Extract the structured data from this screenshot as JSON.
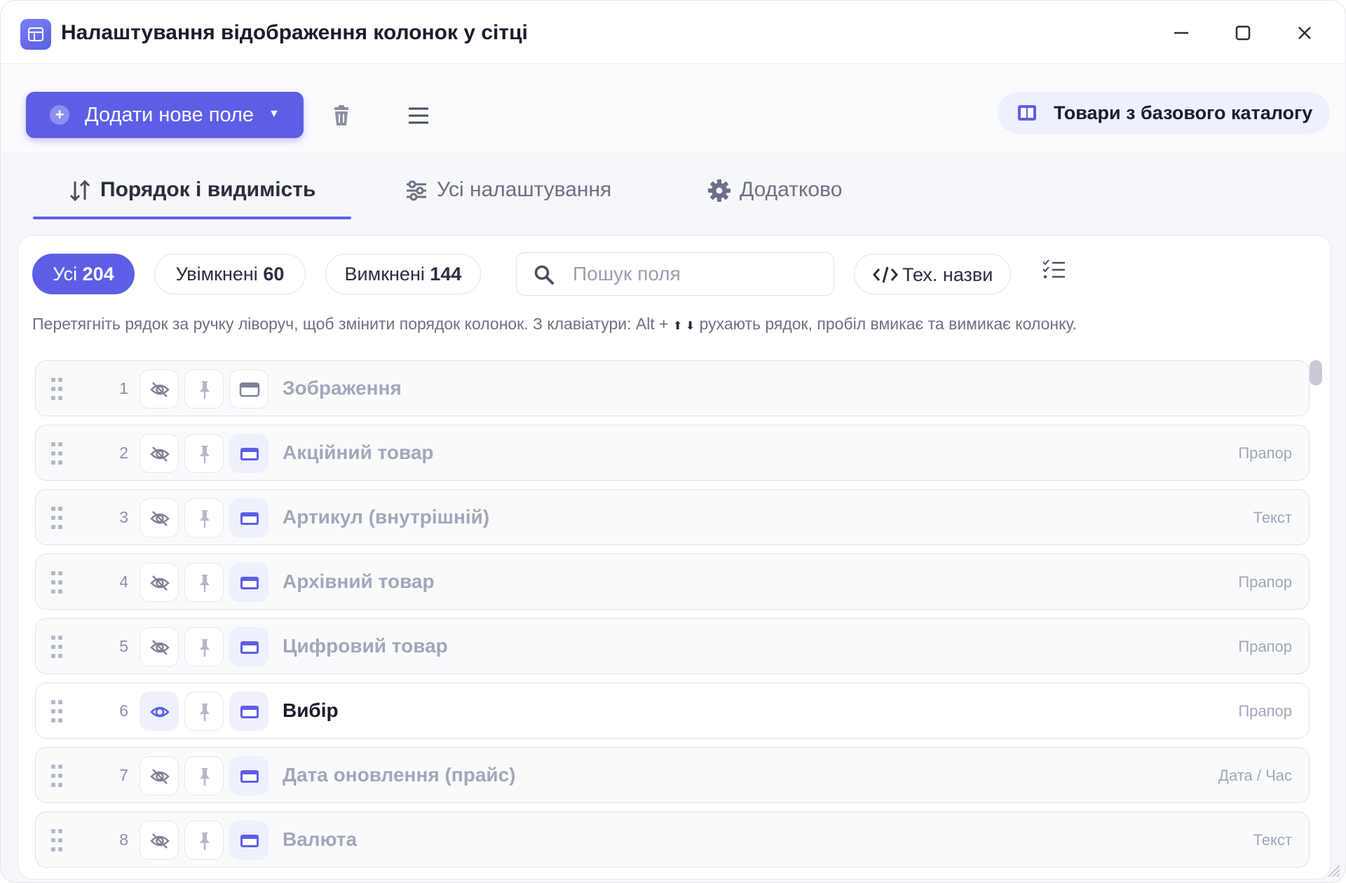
{
  "window": {
    "title": "Налаштування відображення колонок у сітці"
  },
  "toolbar": {
    "add_label": "Додати нове поле",
    "catalog_label": "Товари з базового каталогу"
  },
  "tabs": [
    {
      "label": "Порядок і видимість",
      "active": true
    },
    {
      "label": "Усі налаштування",
      "active": false
    },
    {
      "label": "Додатково",
      "active": false
    }
  ],
  "filters": {
    "all": {
      "label": "Усі",
      "count": "204"
    },
    "on": {
      "label": "Увімкнені",
      "count": "60"
    },
    "off": {
      "label": "Вимкнені",
      "count": "144"
    }
  },
  "search": {
    "placeholder": "Пошук поля",
    "value": ""
  },
  "tech_names_label": "Тех. назви",
  "hint": {
    "before": "Перетягніть рядок за ручку ліворуч, щоб змінити порядок колонок. З клавіатури: Alt +",
    "arrows": "⬆ ⬇",
    "after": "рухають рядок, пробіл вмикає та вимикає колонку."
  },
  "rows": [
    {
      "num": "1",
      "name": "Зображення",
      "type": "",
      "visible": false
    },
    {
      "num": "2",
      "name": "Акційний товар",
      "type": "Прапор",
      "visible": false
    },
    {
      "num": "3",
      "name": "Артикул (внутрішній)",
      "type": "Текст",
      "visible": false
    },
    {
      "num": "4",
      "name": "Архівний товар",
      "type": "Прапор",
      "visible": false
    },
    {
      "num": "5",
      "name": "Цифровий товар",
      "type": "Прапор",
      "visible": false
    },
    {
      "num": "6",
      "name": "Вибір",
      "type": "Прапор",
      "visible": true
    },
    {
      "num": "7",
      "name": "Дата оновлення (прайс)",
      "type": "Дата / Час",
      "visible": false
    },
    {
      "num": "8",
      "name": "Валюта",
      "type": "Текст",
      "visible": false
    }
  ],
  "colors": {
    "accent": "#5c5fe6",
    "accent_soft": "#eef0fb",
    "muted_text": "#a2a7b8"
  }
}
